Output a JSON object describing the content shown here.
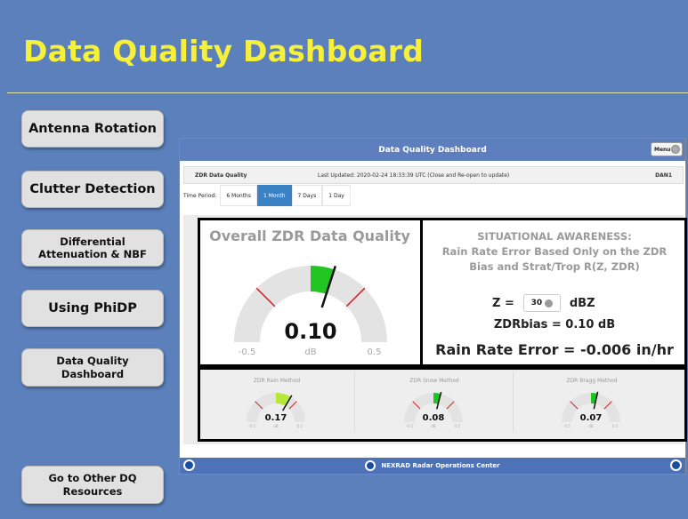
{
  "page_title": "Data Quality Dashboard",
  "nav": {
    "antenna": "Antenna Rotation",
    "clutter": "Clutter Detection",
    "diff_line1": "Differential",
    "diff_line2": "Attenuation & NBF",
    "phidp": "Using PhiDP",
    "dq_line1": "Data Quality",
    "dq_line2": "Dashboard",
    "other_line1": "Go to Other DQ",
    "other_line2": "Resources"
  },
  "window": {
    "title": "Data Quality Dashboard",
    "menu_label": "Menu",
    "product": "ZDR Data Quality",
    "last_updated": "Last Updated: 2020-02-24 18:33:39 UTC (Close and Re-open to update)",
    "site": "DAN1",
    "time_period_label": "Time Period:",
    "periods": [
      "6 Months",
      "1 Month",
      "7 Days",
      "1 Day"
    ],
    "active_period": "1 Month",
    "footer": "NEXRAD Radar Operations Center"
  },
  "overall": {
    "title": "Overall ZDR Data Quality",
    "value": "0.10",
    "min": "-0.5",
    "max": "0.5",
    "unit": "dB",
    "needle_value": 0.1
  },
  "situational": {
    "line1": "SITUATIONAL AWARENESS:",
    "line2": "Rain Rate Error Based Only on the ZDR",
    "line3": "Bias and Strat/Trop R(Z, ZDR)",
    "z_label": "Z =",
    "z_value": "30",
    "z_unit": "dBZ",
    "zdr_bias": "ZDRbias = 0.10 dB",
    "rain_rate_error": "Rain Rate Error = -0.006 in/hr"
  },
  "methods": [
    {
      "title": "ZDR Rain Method",
      "value": "0.17",
      "needle_value": 0.17,
      "min": "-0.5",
      "max": "0.5",
      "unit": "dB",
      "fill": "#b6e83a"
    },
    {
      "title": "ZDR Snow Method",
      "value": "0.08",
      "needle_value": 0.08,
      "min": "-0.5",
      "max": "0.5",
      "unit": "dB",
      "fill": "#22c422"
    },
    {
      "title": "ZDR Bragg Method",
      "value": "0.07",
      "needle_value": 0.07,
      "min": "-0.5",
      "max": "0.5",
      "unit": "dB",
      "fill": "#22c422"
    }
  ],
  "colors": {
    "background": "#5b80bb",
    "title": "#f7f03a",
    "gauge_fill": "#22c422",
    "warning_tick": "#d62020",
    "active_tab": "#3b82c4"
  },
  "icons": [
    "noaa-logo-icon",
    "noaa-logo-icon",
    "noaa-logo-icon",
    "dropdown-icon",
    "menu-icon"
  ]
}
